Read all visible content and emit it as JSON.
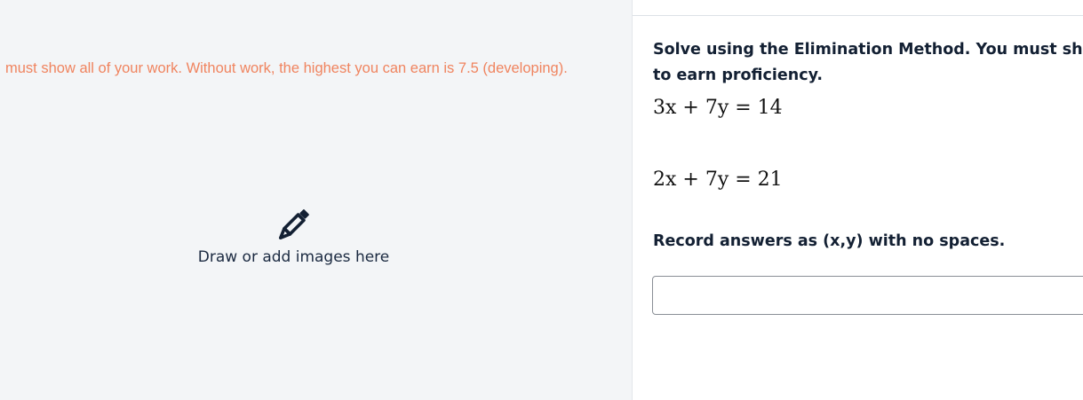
{
  "work_area": {
    "instruction": "must show all of your work. Without work, the highest you can earn is 7.5 (developing).",
    "draw_prompt": "Draw or add images here",
    "draw_icon": "pencil-icon"
  },
  "question": {
    "prompt": "Solve using the Elimination Method. You must show all steps to earn proficiency.",
    "equations": [
      "3x + 7y = 14",
      "2x + 7y = 21"
    ],
    "record_instruction": "Record answers as (x,y) with no spaces.",
    "answer_value": ""
  },
  "colors": {
    "instruction_text": "#f0845f",
    "icon": "#132033",
    "canvas_background": "#f3f5f7"
  }
}
